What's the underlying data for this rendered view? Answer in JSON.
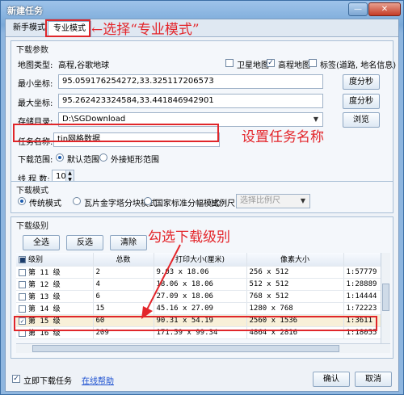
{
  "window": {
    "title": "新建任务",
    "minimize": "—",
    "close": "✕"
  },
  "tabs": [
    "新手模式",
    "专业模式"
  ],
  "annotations": {
    "pro_mode": "←选择“专业模式”",
    "task_name": "设置任务名称",
    "check_level": "勾选下载级别"
  },
  "download_params": {
    "group_title": "下载参数",
    "map_type_label": "地图类型:",
    "map_type_value": "高程,谷歌地球",
    "layers": [
      {
        "label": "卫星地图",
        "checked": false
      },
      {
        "label": "高程地图",
        "checked": true
      },
      {
        "label": "标签(道路, 地名信息)",
        "checked": false
      }
    ],
    "min_coord_label": "最小坐标:",
    "min_coord_value": "95.059176254272,33.325117206573",
    "max_coord_label": "最大坐标:",
    "max_coord_value": "95.262423324584,33.441846942901",
    "dms_button": "度分秒",
    "dir_label": "存储目录:",
    "dir_value": "D:\\SGDownload",
    "browse_button": "浏览",
    "task_name_label": "任务名称:",
    "task_name_value": "tin网格数据",
    "range_label": "下载范围:",
    "range_options": [
      "默认范围",
      "外接矩形范围"
    ],
    "threads_label": "线 程 数:",
    "threads_value": "10"
  },
  "download_mode": {
    "group_title": "下载模式",
    "options": [
      "传统模式",
      "瓦片金字塔分块模式",
      "国家标准分幅模式"
    ],
    "scale_label": "比例尺:",
    "scale_placeholder": "选择比例尺"
  },
  "levels": {
    "group_title": "下载级别",
    "buttons": [
      "全选",
      "反选",
      "清除"
    ],
    "columns": [
      "级别",
      "总数",
      "打印大小(厘米)",
      "像素大小",
      ""
    ],
    "rows": [
      {
        "level": "第 11 级",
        "total": "2",
        "print": "9.03 x 18.06",
        "pixels": "256 x 512",
        "scale": "1:57779",
        "checked": false
      },
      {
        "level": "第 12 级",
        "total": "4",
        "print": "18.06 x 18.06",
        "pixels": "512 x 512",
        "scale": "1:28889",
        "checked": false
      },
      {
        "level": "第 13 级",
        "total": "6",
        "print": "27.09 x 18.06",
        "pixels": "768 x 512",
        "scale": "1:14444",
        "checked": false
      },
      {
        "level": "第 14 级",
        "total": "15",
        "print": "45.16 x 27.09",
        "pixels": "1280 x 768",
        "scale": "1:72223",
        "checked": false
      },
      {
        "level": "第 15 级",
        "total": "60",
        "print": "90.31 x 54.19",
        "pixels": "2560 x 1536",
        "scale": "1:3611",
        "checked": true
      },
      {
        "level": "第 16 级",
        "total": "209",
        "print": "171.59 x 99.34",
        "pixels": "4864 x 2816",
        "scale": "1:18055",
        "checked": false
      }
    ]
  },
  "footer": {
    "download_now_label": "立即下载任务",
    "download_now_checked": true,
    "help_link": "在线帮助",
    "ok_button": "确认",
    "cancel_button": "取消"
  }
}
